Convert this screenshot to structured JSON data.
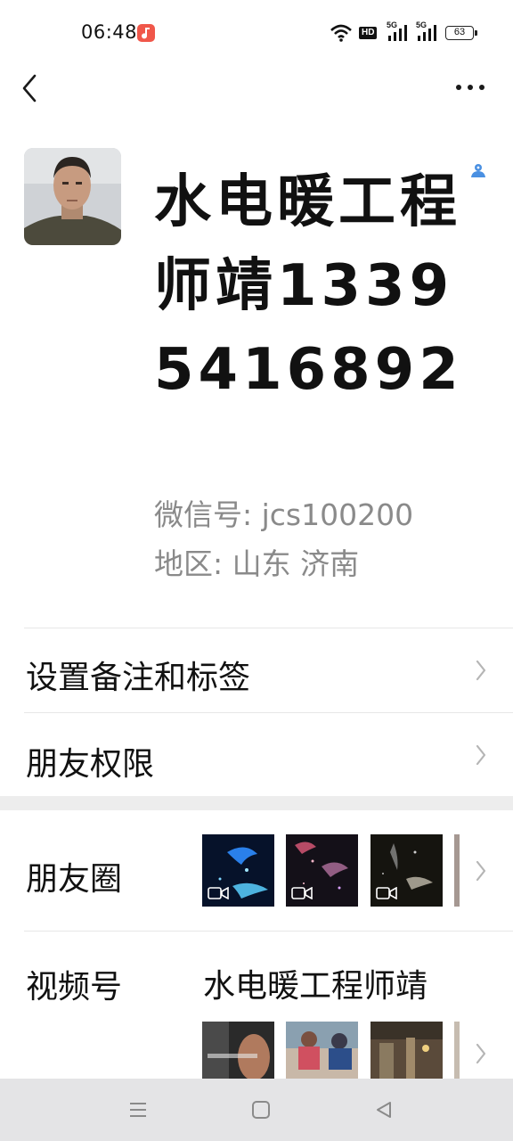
{
  "status_bar": {
    "time": "06:48",
    "battery": "63",
    "hd_label": "HD",
    "network_1": "5G",
    "network_2": "5G"
  },
  "profile": {
    "name": "水电暖工程师靖13395416892",
    "wechat_id": "微信号: jcs100200",
    "region": "地区: 山东  济南"
  },
  "menu": {
    "remark_tags": "设置备注和标签",
    "friend_permissions": "朋友权限"
  },
  "moments": {
    "label": "朋友圈"
  },
  "channels": {
    "label": "视频号",
    "name": "水电暖工程师靖"
  },
  "colors": {
    "accent_blue": "#4a90e2",
    "app_icon_red": "#f0574a",
    "separator": "#ededed"
  }
}
